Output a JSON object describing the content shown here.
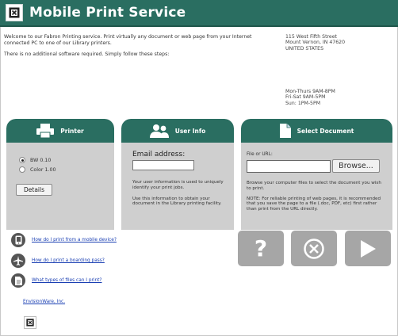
{
  "header": {
    "title": "Mobile Print Service",
    "logo_icon": "envisionware-logo-icon"
  },
  "intro": {
    "line1": "Welcome to our Fabron Printing service. Print virtually any document or web page from your Internet connected PC to one of our Library printers.",
    "line2": "There is no additional software required. Simply follow these steps:"
  },
  "address": {
    "street": "115 West Fifth Street",
    "city": "Mount Vernon, IN  47620",
    "country": "UNITED STATES"
  },
  "hours": {
    "weekday": "Mon-Thurs  9AM-8PM",
    "friday": "Fri-Sat  9AM-5PM",
    "sunday": "Sun: 1PM-5PM"
  },
  "printer": {
    "heading": "Printer",
    "options": [
      {
        "label": "BW 0.10",
        "selected": true
      },
      {
        "label": "Color 1.00",
        "selected": false
      }
    ],
    "details_label": "Details"
  },
  "user_info": {
    "heading": "User Info",
    "email_label": "Email address:",
    "email_value": "",
    "text1": "Your user information is used to uniquely identify your print jobs.",
    "text2": "Use this information to obtain your document in the Library printing facility."
  },
  "select_document": {
    "heading": "Select Document",
    "file_label": "File or URL:",
    "file_value": "",
    "browse_label": "Browse...",
    "text1": "Browse your computer files to select the document you wish to print.",
    "text2": "NOTE: For reliable printing of web pages, it is recommended that you save the page to a file (.doc, PDF, etc) first rather than print from the URL directly."
  },
  "help_links": [
    {
      "label": "How do I print from a mobile device?",
      "icon": "mobile-device-icon"
    },
    {
      "label": "How do I print a boarding pass?",
      "icon": "airplane-icon"
    },
    {
      "label": "What types of files can I print?",
      "icon": "document-icon"
    }
  ],
  "footer": {
    "vendor_link": "EnvisionWare, Inc."
  },
  "actions": {
    "help_symbol": "?",
    "cancel_icon": "cancel-icon",
    "submit_icon": "play-icon"
  },
  "colors": {
    "brand": "#2a6e61",
    "panel": "#cfcfcf",
    "button": "#a6a6a6",
    "link": "#1a3fb3"
  }
}
